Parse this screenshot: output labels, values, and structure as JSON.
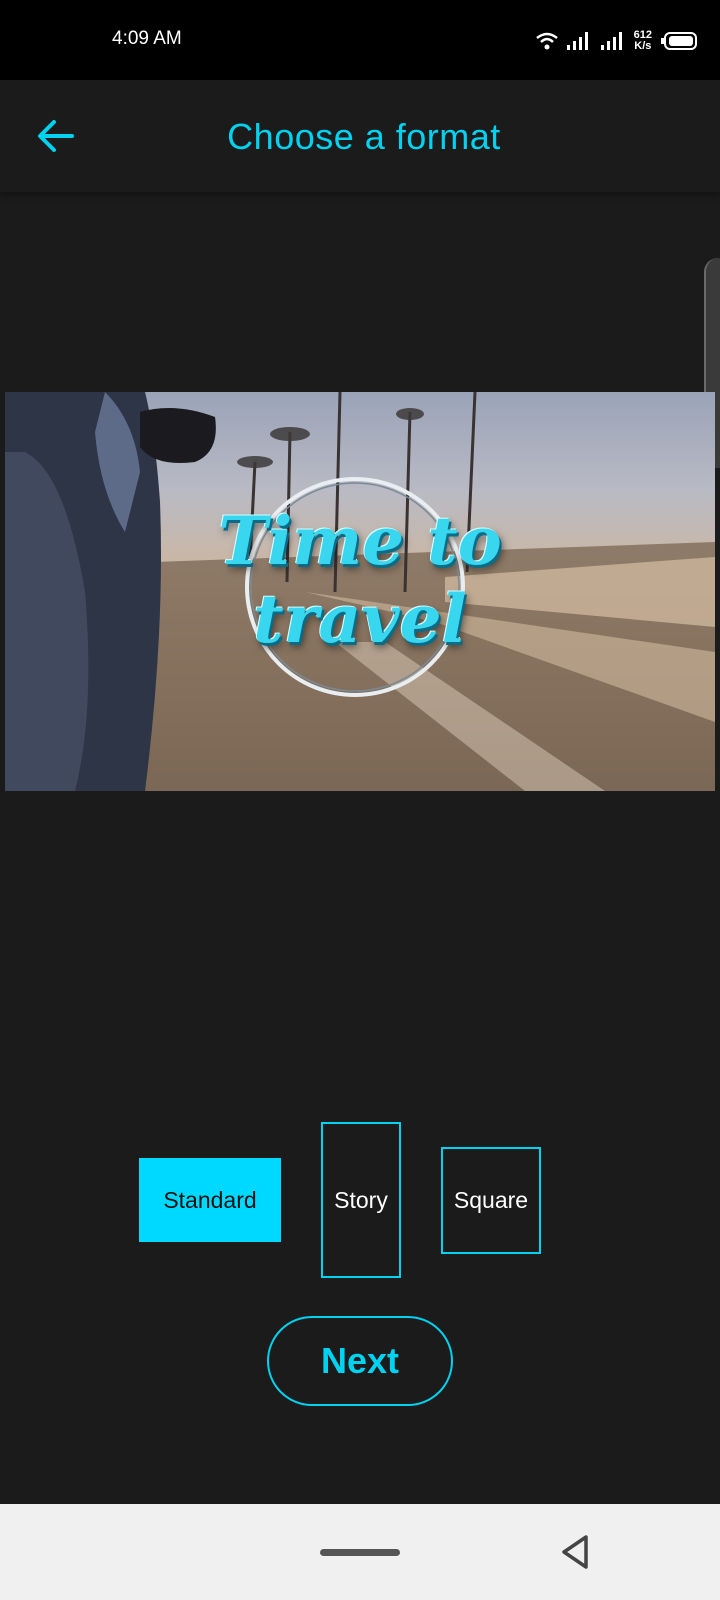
{
  "status_bar": {
    "time": "4:09 AM",
    "net_speed_value": "612",
    "net_speed_unit": "K/s",
    "icons": [
      "wifi-icon",
      "signal-icon",
      "signal-icon",
      "battery-icon"
    ]
  },
  "header": {
    "title": "Choose a format",
    "back_icon": "arrow-left-icon"
  },
  "preview": {
    "title_line1": "Time to",
    "title_line2": "travel"
  },
  "formats": {
    "options": [
      {
        "label": "Standard",
        "selected": true
      },
      {
        "label": "Story",
        "selected": false
      },
      {
        "label": "Square",
        "selected": false
      }
    ]
  },
  "actions": {
    "next_label": "Next"
  },
  "colors": {
    "accent": "#00d2f0",
    "selected_fill": "#00d9ff",
    "background": "#1b1b1c",
    "nav_bar": "#f0f0f0"
  }
}
